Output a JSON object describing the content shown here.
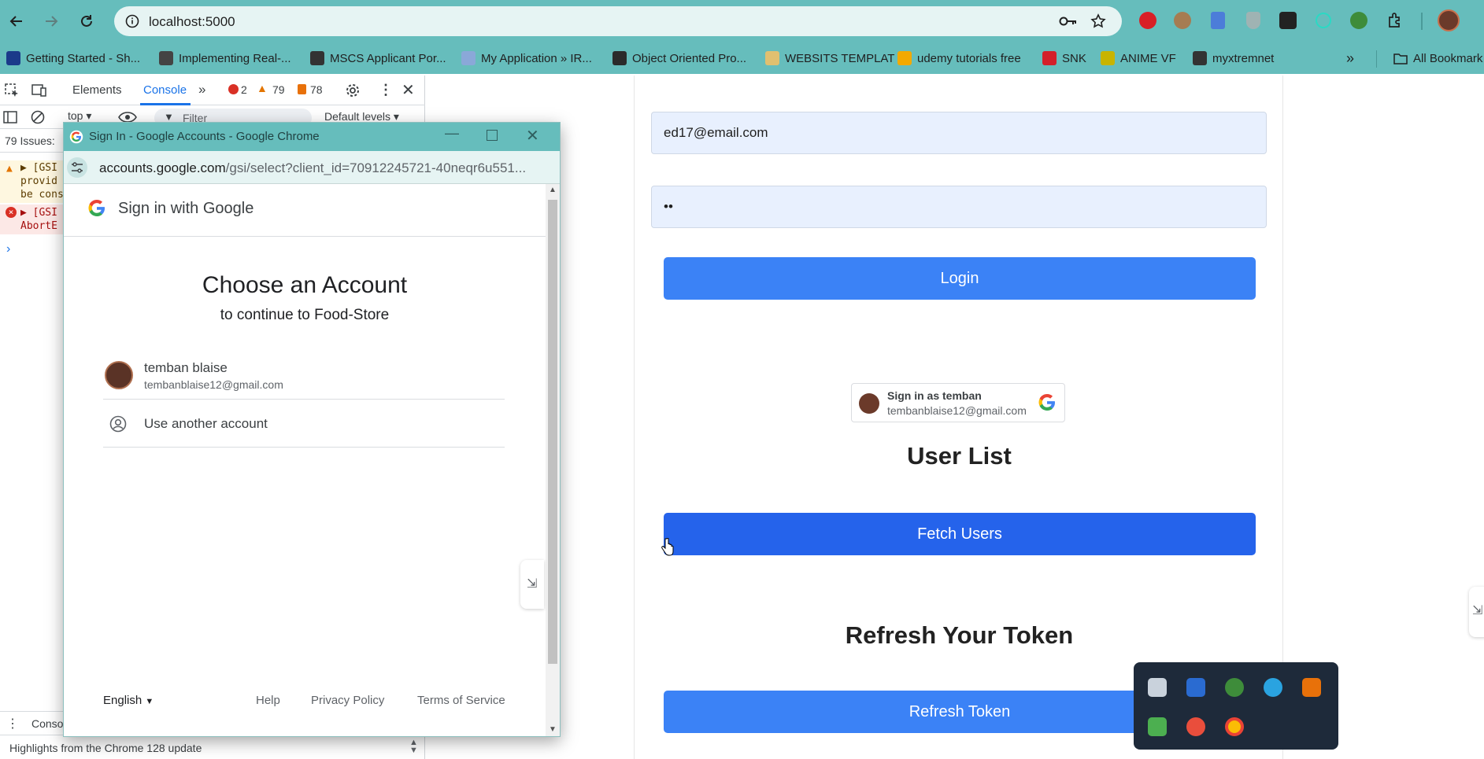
{
  "browser": {
    "url": "localhost:5000",
    "bookmarks": [
      {
        "label": "Getting Started - Sh...",
        "color": "#1b3a8a"
      },
      {
        "label": "Implementing Real-...",
        "color": "#444444"
      },
      {
        "label": "MSCS Applicant Por...",
        "color": "#333333"
      },
      {
        "label": "My Application » IR...",
        "color": "#8aa8d8"
      },
      {
        "label": "Object Oriented Pro...",
        "color": "#2b2b2b"
      },
      {
        "label": "WEBSITS TEMPLAT",
        "color": "#e0c070"
      },
      {
        "label": "udemy tutorials free",
        "color": "#f2a900"
      },
      {
        "label": "SNK",
        "color": "#d3202a"
      },
      {
        "label": "ANIME VF",
        "color": "#c8b400"
      },
      {
        "label": "myxtremnet",
        "color": "#333333"
      }
    ],
    "all_bookmarks": "All Bookmark"
  },
  "devtools": {
    "tabs": {
      "elements": "Elements",
      "console": "Console"
    },
    "counts": {
      "errors": "2",
      "warnings": "79",
      "info": "78"
    },
    "context": "top",
    "filter_placeholder": "Filter",
    "levels": "Default levels",
    "issues": "79 Issues:",
    "logs": [
      {
        "lines": [
          "▶ [GSI",
          "provid",
          "be cons"
        ]
      },
      {
        "lines": [
          "▶ [GSI",
          "AbortE"
        ]
      }
    ],
    "prompt": "›",
    "bottom_tab": "Conso",
    "status": "Highlights from the Chrome 128 update"
  },
  "popup": {
    "window_title": "Sign In - Google Accounts - Google Chrome",
    "url_host": "accounts.google.com",
    "url_path": "/gsi/select?client_id=70912245721-40neqr6u551...",
    "header": "Sign in with Google",
    "title": "Choose an Account",
    "subtitle": "to continue to Food-Store",
    "account": {
      "name": "temban blaise",
      "email": "tembanblaise12@gmail.com"
    },
    "another": "Use another account",
    "language": "English",
    "footer": {
      "help": "Help",
      "privacy": "Privacy Policy",
      "terms": "Terms of Service"
    }
  },
  "page": {
    "email_value": "ed17@email.com",
    "password_value": "••",
    "login": "Login",
    "google_button": {
      "title": "Sign in as temban",
      "email": "tembanblaise12@gmail.com"
    },
    "user_list": "User List",
    "fetch_users": "Fetch Users",
    "refresh_heading": "Refresh Your Token",
    "refresh_token": "Refresh Token"
  },
  "colors": {
    "chrome_teal": "#66bdbc",
    "primary_blue": "#3b82f6",
    "primary_blue_hover": "#2563eb",
    "field_bg": "#e8f0fe"
  }
}
